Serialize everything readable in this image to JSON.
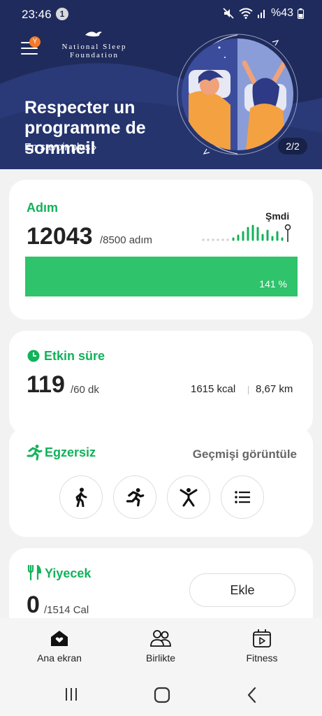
{
  "status_bar": {
    "time": "23:46",
    "notification_count": "1",
    "battery": "%43"
  },
  "header": {
    "menu_badge": "Y",
    "logo_line1": "National Sleep",
    "logo_line2": "Foundation"
  },
  "banner": {
    "title": "Respecter un programme de sommeil",
    "link": "En savoir plus ›",
    "pager": "2/2"
  },
  "steps_card": {
    "title": "Adım",
    "count": "12043",
    "goal": "/8500 adım",
    "progress_label": "141 %",
    "progress_fraction": 1.0,
    "now_label": "Şmdi"
  },
  "active_card": {
    "title": "Etkin süre",
    "value": "119",
    "goal": "/60 dk",
    "kcal": "1615 kcal",
    "distance": "8,67 km"
  },
  "exercise_card": {
    "title": "Egzersiz",
    "history_link": "Geçmişi görüntüle",
    "buttons": [
      "walking-icon",
      "running-icon",
      "workout-icon",
      "list-icon"
    ]
  },
  "food_card": {
    "title": "Yiyecek",
    "value": "0",
    "goal": "/1514 Cal",
    "add_label": "Ekle"
  },
  "bottom_nav": {
    "home": "Ana ekran",
    "together": "Birlikte",
    "fitness": "Fitness"
  },
  "colors": {
    "accent_green": "#12b25a",
    "banner_blue": "#1e2a5a"
  }
}
